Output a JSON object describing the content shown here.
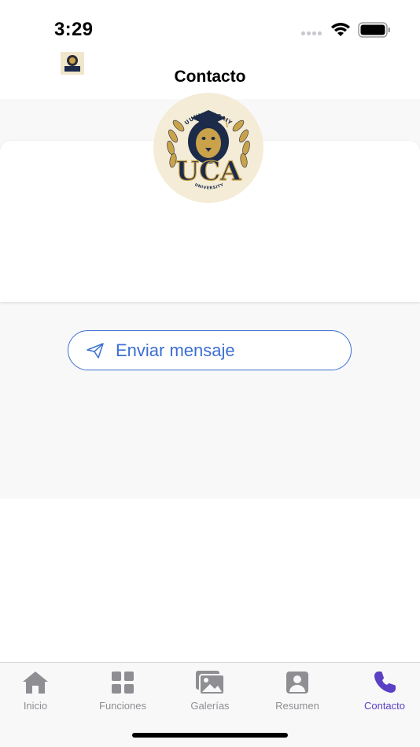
{
  "status_bar": {
    "time": "3:29"
  },
  "header": {
    "title": "Contacto"
  },
  "logo": {
    "top_arc": "UUNVEERSAIY",
    "initials": "UCA",
    "bottom_arc": "UNIVERSITY"
  },
  "contact": {
    "send_message_label": "Enviar mensaje"
  },
  "tabs": [
    {
      "label": "Inicio",
      "icon": "home-icon"
    },
    {
      "label": "Funciones",
      "icon": "grid-icon"
    },
    {
      "label": "Galerías",
      "icon": "gallery-icon"
    },
    {
      "label": "Resumen",
      "icon": "profile-icon"
    },
    {
      "label": "Contacto",
      "icon": "phone-icon",
      "active": true
    }
  ],
  "colors": {
    "accent": "#3b6fd1",
    "active_tab": "#5b3fc4",
    "inactive_tab": "#8e8e93",
    "logo_gold": "#c9a24a",
    "logo_navy": "#1c2b4a"
  }
}
